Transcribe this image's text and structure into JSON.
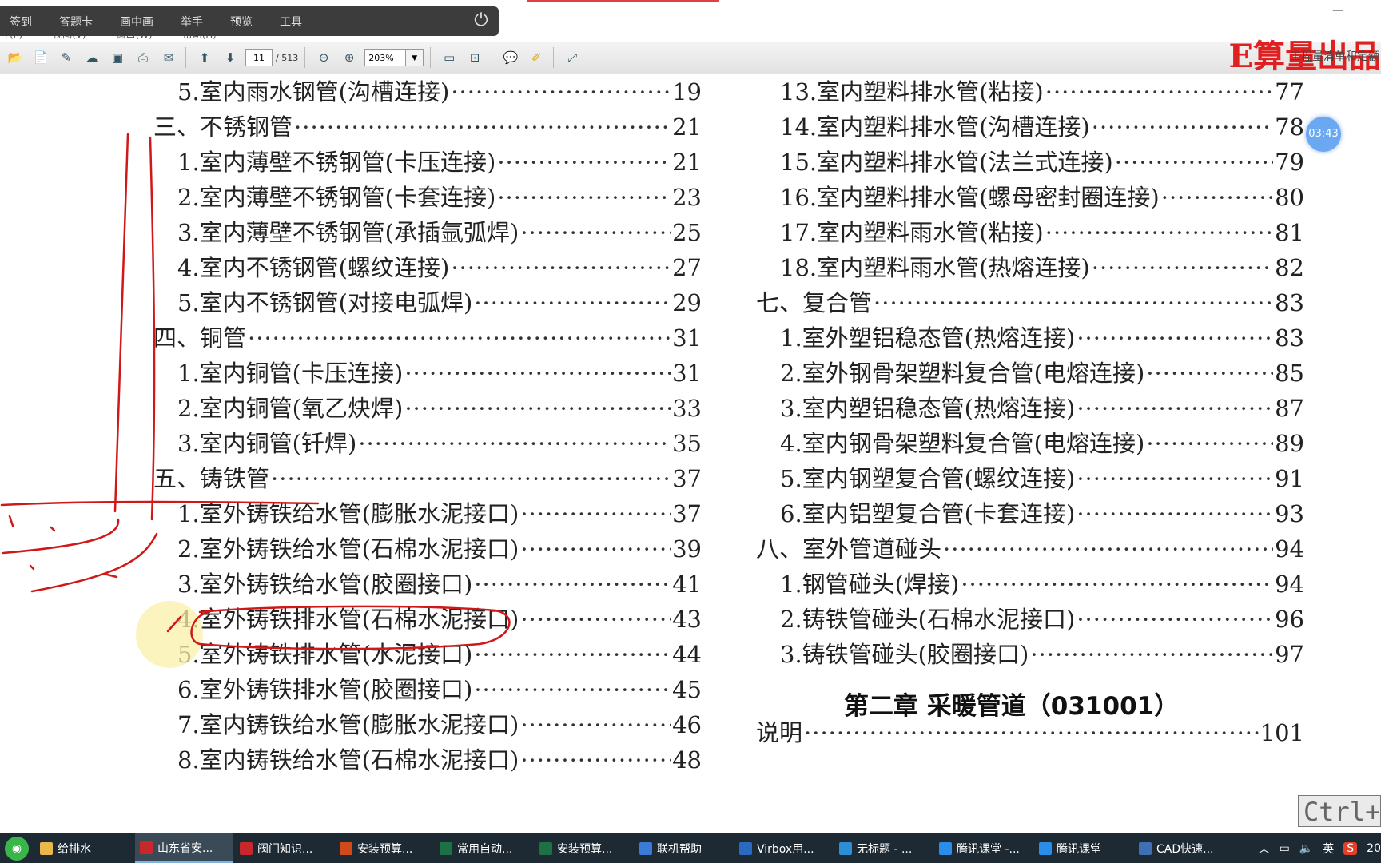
{
  "top_menu": [
    "件(F)",
    "视图(V)",
    "窗口(W)",
    "帮助(H)"
  ],
  "classroom_bar": {
    "items": [
      "签到",
      "答题卡",
      "画中画",
      "举手",
      "预览",
      "工具"
    ]
  },
  "toolbar": {
    "page_current": "11",
    "page_total": "/ 513",
    "zoom": "203%"
  },
  "brand": {
    "title": "E算量出品",
    "subtitle": "工程量清单和定额"
  },
  "toc_left": [
    {
      "text": "5.室内雨水钢管(沟槽连接)",
      "page": "19",
      "indent": 2
    },
    {
      "text": "三、不锈钢管",
      "page": "21",
      "indent": 1
    },
    {
      "text": "1.室内薄壁不锈钢管(卡压连接)",
      "page": "21",
      "indent": 2
    },
    {
      "text": "2.室内薄壁不锈钢管(卡套连接)",
      "page": "23",
      "indent": 2
    },
    {
      "text": "3.室内薄壁不锈钢管(承插氩弧焊)",
      "page": "25",
      "indent": 2
    },
    {
      "text": "4.室内不锈钢管(螺纹连接)",
      "page": "27",
      "indent": 2
    },
    {
      "text": "5.室内不锈钢管(对接电弧焊)",
      "page": "29",
      "indent": 2
    },
    {
      "text": "四、铜管",
      "page": "31",
      "indent": 1
    },
    {
      "text": "1.室内铜管(卡压连接)",
      "page": "31",
      "indent": 2
    },
    {
      "text": "2.室内铜管(氧乙炔焊)",
      "page": "33",
      "indent": 2
    },
    {
      "text": "3.室内铜管(钎焊)",
      "page": "35",
      "indent": 2
    },
    {
      "text": "五、铸铁管",
      "page": "37",
      "indent": 1
    },
    {
      "text": "1.室外铸铁给水管(膨胀水泥接口)",
      "page": "37",
      "indent": 2
    },
    {
      "text": "2.室外铸铁给水管(石棉水泥接口)",
      "page": "39",
      "indent": 2
    },
    {
      "text": "3.室外铸铁给水管(胶圈接口)",
      "page": "41",
      "indent": 2
    },
    {
      "text": "4.室外铸铁排水管(石棉水泥接口)",
      "page": "43",
      "indent": 2
    },
    {
      "text": "5.室外铸铁排水管(水泥接口)",
      "page": "44",
      "indent": 2
    },
    {
      "text": "6.室外铸铁排水管(胶圈接口)",
      "page": "45",
      "indent": 2
    },
    {
      "text": "7.室内铸铁给水管(膨胀水泥接口)",
      "page": "46",
      "indent": 2
    },
    {
      "text": "8.室内铸铁给水管(石棉水泥接口)",
      "page": "48",
      "indent": 2
    }
  ],
  "toc_right": [
    {
      "text": "13.室内塑料排水管(粘接)",
      "page": "77",
      "indent": 2
    },
    {
      "text": "14.室内塑料排水管(沟槽连接)",
      "page": "78",
      "indent": 2
    },
    {
      "text": "15.室内塑料排水管(法兰式连接)",
      "page": "79",
      "indent": 2
    },
    {
      "text": "16.室内塑料排水管(螺母密封圈连接)",
      "page": "80",
      "indent": 2
    },
    {
      "text": "17.室内塑料雨水管(粘接)",
      "page": "81",
      "indent": 2
    },
    {
      "text": "18.室内塑料雨水管(热熔连接)",
      "page": "82",
      "indent": 2
    },
    {
      "text": "七、复合管",
      "page": "83",
      "indent": 1
    },
    {
      "text": "1.室外塑铝稳态管(热熔连接)",
      "page": "83",
      "indent": 2
    },
    {
      "text": "2.室外钢骨架塑料复合管(电熔连接)",
      "page": "85",
      "indent": 2
    },
    {
      "text": "3.室内塑铝稳态管(热熔连接)",
      "page": "87",
      "indent": 2
    },
    {
      "text": "4.室内钢骨架塑料复合管(电熔连接)",
      "page": "89",
      "indent": 2
    },
    {
      "text": "5.室内钢塑复合管(螺纹连接)",
      "page": "91",
      "indent": 2
    },
    {
      "text": "6.室内铝塑复合管(卡套连接)",
      "page": "93",
      "indent": 2
    },
    {
      "text": "八、室外管道碰头",
      "page": "94",
      "indent": 1
    },
    {
      "text": "1.钢管碰头(焊接)",
      "page": "94",
      "indent": 2
    },
    {
      "text": "2.铸铁管碰头(石棉水泥接口)",
      "page": "96",
      "indent": 2
    },
    {
      "text": "3.铸铁管碰头(胶圈接口)",
      "page": "97",
      "indent": 2
    }
  ],
  "chapter_heading": "第二章 采暖管道（031001）",
  "toc_right_bottom": {
    "text": "说明",
    "page": "101"
  },
  "timer_badge": "03:43",
  "ctrl_overlay": "Ctrl+",
  "taskbar": {
    "items": [
      {
        "label": "给排水",
        "icon": "folder-icon",
        "color": "#e8b84a"
      },
      {
        "label": "山东省安...",
        "icon": "pdf-icon",
        "color": "#c8282b",
        "active": true
      },
      {
        "label": "阀门知识...",
        "icon": "pdf-icon",
        "color": "#c8282b"
      },
      {
        "label": "安装预算...",
        "icon": "ppt-icon",
        "color": "#d04a1c"
      },
      {
        "label": "常用自动...",
        "icon": "excel-icon",
        "color": "#1e7145"
      },
      {
        "label": "安装预算...",
        "icon": "excel-icon",
        "color": "#1e7145"
      },
      {
        "label": "联机帮助",
        "icon": "help-icon",
        "color": "#3a7bd5"
      },
      {
        "label": "Virbox用...",
        "icon": "shield-icon",
        "color": "#2a6ac0"
      },
      {
        "label": "无标题 - ...",
        "icon": "app-icon",
        "color": "#2c8fd6"
      },
      {
        "label": "腾讯课堂 -...",
        "icon": "tencent-icon",
        "color": "#2a8ee8"
      },
      {
        "label": "腾讯课堂",
        "icon": "tencent-icon",
        "color": "#2a8ee8"
      },
      {
        "label": "CAD快速...",
        "icon": "cad-icon",
        "color": "#3f6fb5"
      }
    ],
    "tray": {
      "ime": "英",
      "clock": "20"
    }
  }
}
